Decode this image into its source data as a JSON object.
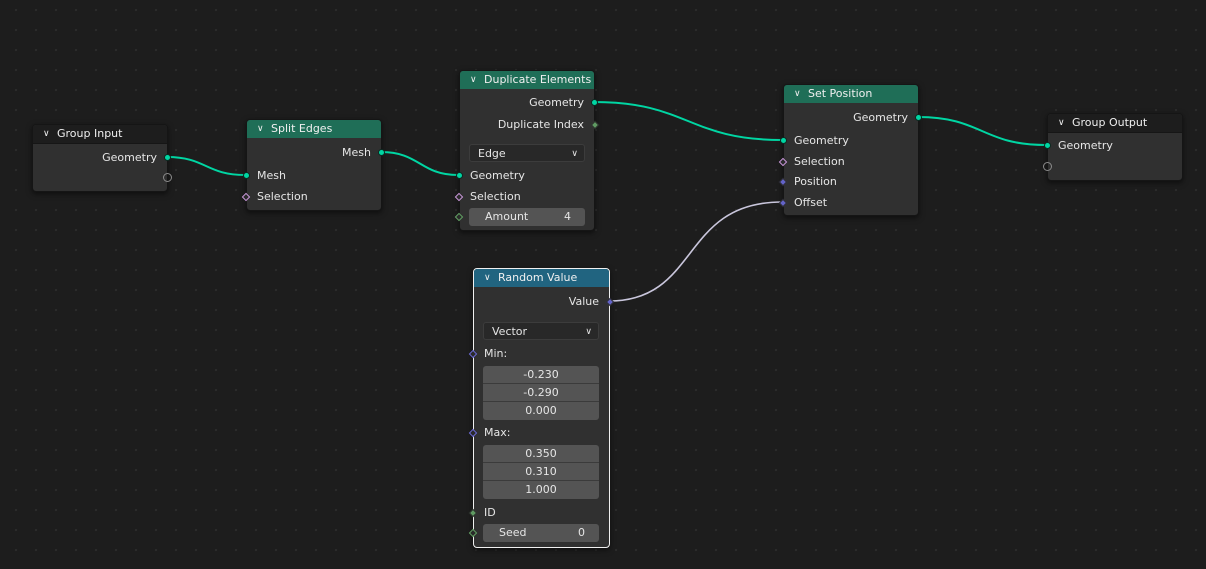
{
  "editor": "Geometry Node Editor",
  "colors": {
    "geometry_socket": "#00d6a3",
    "geometry_header": "#1f6e57",
    "utility_header": "#216480",
    "background": "#1d1d1d",
    "node_body": "#303030"
  },
  "nodes": {
    "group_input": {
      "title": "Group Input",
      "outputs": [
        "Geometry"
      ]
    },
    "split_edges": {
      "title": "Split Edges",
      "outputs": [
        "Mesh"
      ],
      "inputs": [
        "Mesh",
        "Selection"
      ]
    },
    "duplicate_elements": {
      "title": "Duplicate Elements",
      "outputs": [
        "Geometry",
        "Duplicate Index"
      ],
      "domain": "Edge",
      "inputs": [
        "Geometry",
        "Selection"
      ],
      "amount": {
        "label": "Amount",
        "value": "4"
      }
    },
    "set_position": {
      "title": "Set Position",
      "outputs": [
        "Geometry"
      ],
      "inputs": [
        "Geometry",
        "Selection",
        "Position",
        "Offset"
      ]
    },
    "group_output": {
      "title": "Group Output",
      "inputs": [
        "Geometry"
      ]
    },
    "random_value": {
      "title": "Random Value",
      "outputs": [
        "Value"
      ],
      "data_type": "Vector",
      "min_label": "Min:",
      "min": [
        "-0.230",
        "-0.290",
        "0.000"
      ],
      "max_label": "Max:",
      "max": [
        "0.350",
        "0.310",
        "1.000"
      ],
      "id_label": "ID",
      "seed": {
        "label": "Seed",
        "value": "0"
      }
    }
  },
  "links": [
    {
      "from": "Group Input.Geometry",
      "to": "Split Edges.Mesh"
    },
    {
      "from": "Split Edges.Mesh",
      "to": "Duplicate Elements.Geometry"
    },
    {
      "from": "Duplicate Elements.Geometry",
      "to": "Set Position.Geometry"
    },
    {
      "from": "Set Position.Geometry",
      "to": "Group Output.Geometry"
    },
    {
      "from": "Random Value.Value",
      "to": "Set Position.Offset"
    }
  ]
}
